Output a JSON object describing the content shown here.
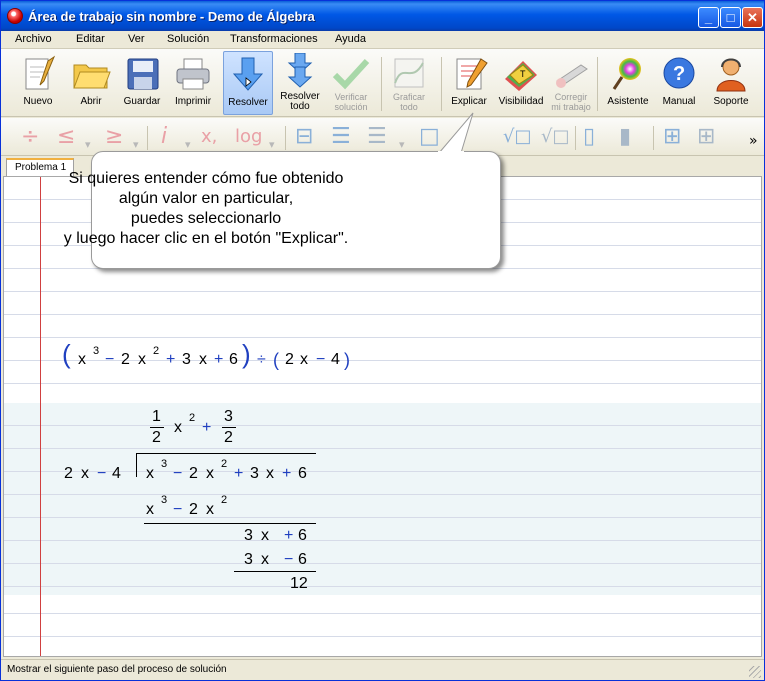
{
  "window": {
    "title": "Área de trabajo sin nombre - Demo de Álgebra",
    "min_glyph": "_",
    "max_glyph": "□",
    "close_glyph": "✕"
  },
  "menu": [
    "Archivo",
    "Editar",
    "Ver",
    "Solución",
    "Transformaciones",
    "Ayuda"
  ],
  "toolbar": {
    "new": "Nuevo",
    "open": "Abrir",
    "save": "Guardar",
    "print": "Imprimir",
    "solve": "Resolver",
    "solve_all": [
      "Resolver",
      "todo"
    ],
    "verify": [
      "Verificar",
      "solución"
    ],
    "graph_all": [
      "Graficar",
      "todo"
    ],
    "explain": "Explicar",
    "visibility": "Visibilidad",
    "correct": [
      "Corregir",
      "mi trabajo"
    ],
    "assistant": "Asistente",
    "manual": "Manual",
    "support": "Soporte"
  },
  "toolbar2": {
    "div": "÷",
    "le": "≤",
    "ge": "≥",
    "i": "i",
    "x": "x,",
    "log": "log",
    "more": "»"
  },
  "tabs": {
    "active": "Problema 1"
  },
  "balloon": {
    "lines": [
      "Si quieres entender cómo fue obtenido",
      "algún valor en particular,",
      "puedes seleccionarlo",
      "y luego hacer clic en el botón \"Explicar\"."
    ]
  },
  "expression": {
    "open": "(",
    "x": "x",
    "e3": "3",
    "minus": "−",
    "two": "2",
    "e2": "2",
    "plus": "+",
    "three": "3",
    "six": "6",
    "close": ")",
    "div": "÷",
    "four": "4"
  },
  "division": {
    "quot_num1": "1",
    "quot_den1": "2",
    "quot_x": "x",
    "quot_e": "2",
    "quot_plus": "+",
    "quot_num2": "3",
    "quot_den2": "2",
    "divisor": [
      "2",
      "x",
      "−",
      "4"
    ],
    "dividend": [
      "x",
      "3",
      "−",
      "2",
      "x",
      "2",
      "+",
      "3",
      "x",
      "+",
      "6"
    ],
    "sub1": [
      "x",
      "3",
      "−",
      "2",
      "x",
      "2"
    ],
    "rem1": [
      "3",
      "x",
      "+",
      "6"
    ],
    "sub2": [
      "3",
      "x",
      "−",
      "6"
    ],
    "remainder": "12"
  },
  "status": "Mostrar el siguiente paso del proceso de solución",
  "colors": {
    "title_bar": "#0058e6",
    "math_operator": "#2040c0",
    "margin_line": "#d04040",
    "band": "#eef6f8"
  }
}
